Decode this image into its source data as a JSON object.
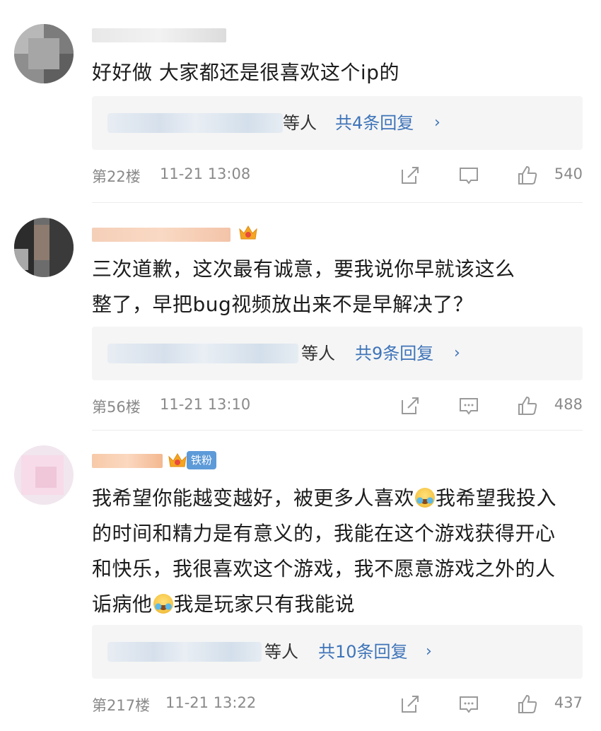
{
  "comments": [
    {
      "text": "好好做 大家都还是很喜欢这个ip的",
      "reply_who": "等人",
      "reply_count": "共4条回复",
      "floor": "第22楼",
      "time": "11-21 13:08",
      "likes": "540"
    },
    {
      "text_lines": [
        "三次道歉，这次最有诚意，要我说你早就该这么",
        "整了，早把bug视频放出来不是早解决了？"
      ],
      "reply_who": "等人",
      "reply_count": "共9条回复",
      "floor": "第56楼",
      "time": "11-21 13:10",
      "likes": "488"
    },
    {
      "badge": "铁粉",
      "text_parts": [
        "我希望你能越变越好，被更多人喜欢",
        "我希望我投入的时间和精力是有意义的，我能在这个游戏获得开心和快乐，我很喜欢这个游戏，我不愿意游戏之外的人诟病他",
        "我是玩家只有我能说"
      ],
      "reply_who": "等人",
      "reply_count": "共10条回复",
      "floor": "第217楼",
      "time": "11-21 13:22",
      "likes": "437"
    }
  ],
  "icons": [
    "share-icon",
    "comment-icon",
    "like-icon",
    "chevron-right-icon",
    "crown-icon",
    "emoji-icon"
  ],
  "colors": {
    "link": "#3e74b9",
    "meta": "#8a8a8a",
    "reply_bg": "#f5f5f5",
    "badge": "#5d9ad8"
  }
}
